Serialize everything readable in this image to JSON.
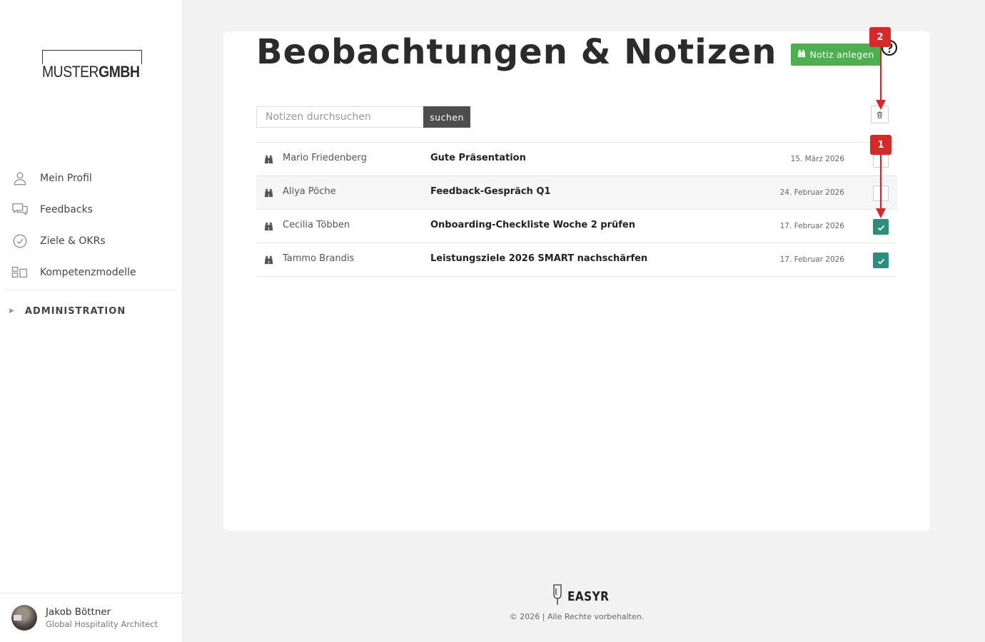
{
  "sidebar": {
    "logo": {
      "part1": "MUSTER",
      "part2": "GMBH"
    },
    "nav": [
      {
        "id": "profil",
        "label": "Mein Profil",
        "icon": "user-icon"
      },
      {
        "id": "feedbacks",
        "label": "Feedbacks",
        "icon": "chat-bubbles-icon"
      },
      {
        "id": "ziele",
        "label": "Ziele & OKRs",
        "icon": "check-circle-icon"
      },
      {
        "id": "kompetenz",
        "label": "Kompetenzmodelle",
        "icon": "blocks-icon"
      }
    ],
    "admin": {
      "label": "ADMINISTRATION",
      "expanded": false
    },
    "user": {
      "name": "Jakob Böttner",
      "role": "Global Hospitality Architect"
    }
  },
  "main": {
    "title": "Beobachtungen & Notizen",
    "new_button": "Notiz anlegen",
    "search": {
      "placeholder": "Notizen durchsuchen",
      "value": "",
      "button": "suchen"
    },
    "notes": [
      {
        "person": "Mario Friedenberg",
        "subject": "Gute Präsentation",
        "date": "15. März 2026",
        "checked": false
      },
      {
        "person": "Aliya Pöche",
        "subject": "Feedback-Gespräch Q1",
        "date": "24. Februar 2026",
        "checked": false
      },
      {
        "person": "Cecilia Többen",
        "subject": "Onboarding-Checkliste Woche 2 prüfen",
        "date": "17. Februar 2026",
        "checked": true
      },
      {
        "person": "Tammo Brandis",
        "subject": "Leistungsziele 2026 SMART nachschärfen",
        "date": "17. Februar 2026",
        "checked": true
      }
    ]
  },
  "annotations": {
    "badge1": "1",
    "badge2": "2"
  },
  "footer": {
    "brand": "EASYR",
    "copyright": "© 2026 | Alle Rechte vorbehalten."
  },
  "colors": {
    "primary_green": "#4caf50",
    "check_teal": "#2e8c7d",
    "annotation_red": "#d42a2a",
    "dark_button": "#4d4d4d"
  }
}
